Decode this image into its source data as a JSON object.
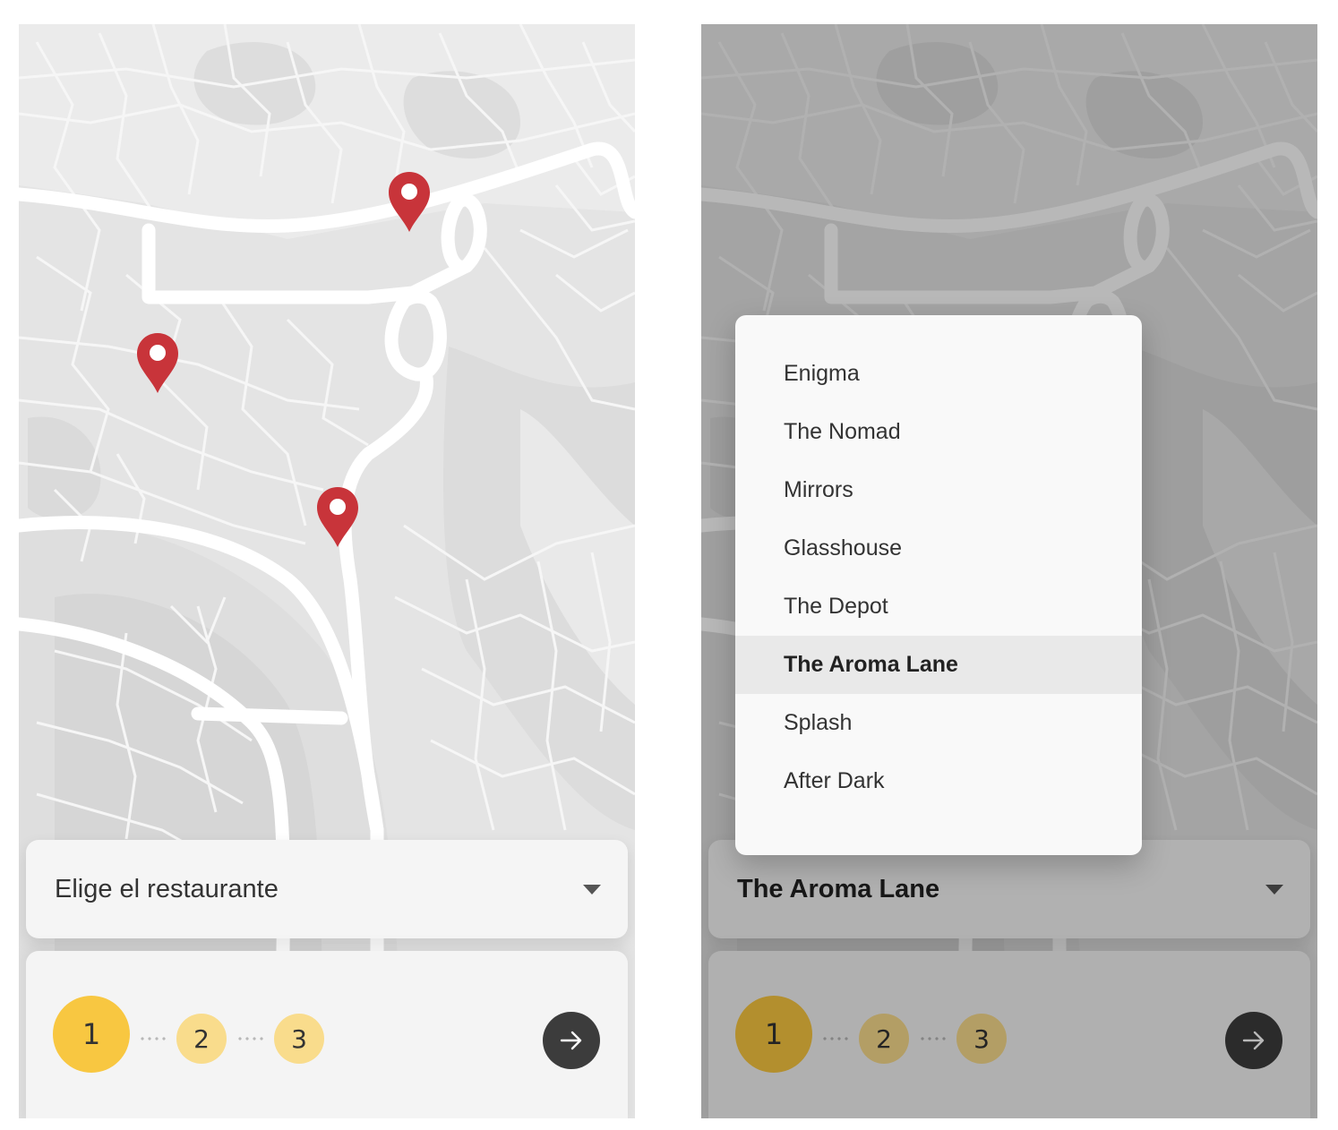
{
  "left_screen": {
    "select": {
      "placeholder": "Elige el restaurante"
    },
    "stepper": {
      "steps": [
        "1",
        "2",
        "3"
      ],
      "current_step": 1
    }
  },
  "right_screen": {
    "select": {
      "value": "The Aroma Lane"
    },
    "dropdown": {
      "options": [
        "Enigma",
        "The Nomad",
        "Mirrors",
        "Glasshouse",
        "The Depot",
        "The Aroma Lane",
        "Splash",
        "After Dark"
      ],
      "selected": "The Aroma Lane"
    },
    "stepper": {
      "steps": [
        "1",
        "2",
        "3"
      ],
      "current_step": 1
    }
  },
  "icons": {
    "map_pin": "map-pin-icon",
    "caret": "caret-down-icon",
    "next": "arrow-right-icon"
  },
  "colors": {
    "pin": "#c8343a",
    "step_active": "#f8c741",
    "step_inactive": "#f9dc8c",
    "next_button": "#3c3c3c",
    "map_background": "#e4e4e4"
  }
}
